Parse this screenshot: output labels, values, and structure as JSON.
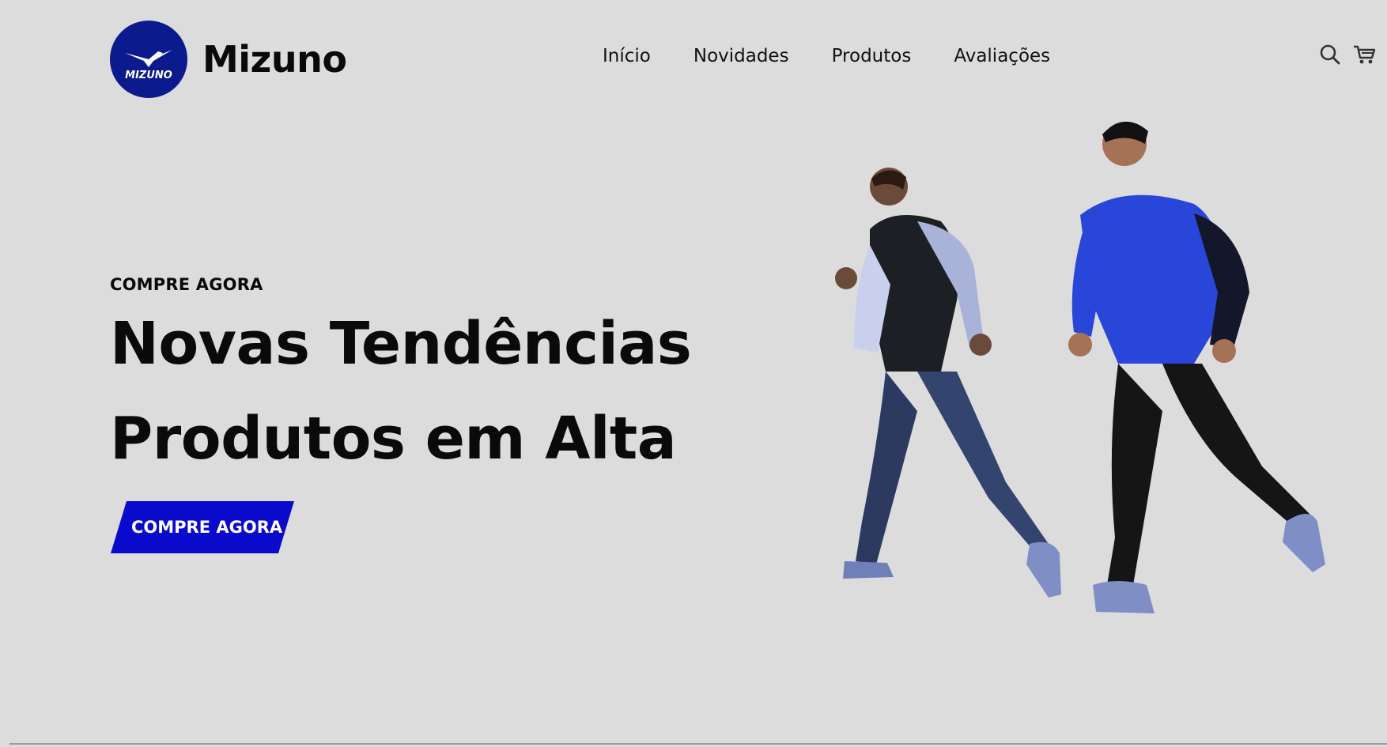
{
  "header": {
    "brand": "Mizuno",
    "logo_text": "MIZUNO",
    "nav": [
      "Início",
      "Novidades",
      "Produtos",
      "Avaliações"
    ],
    "icons": [
      "search-icon",
      "cart-icon"
    ]
  },
  "hero": {
    "eyebrow": "COMPRE AGORA",
    "headline_line1": "Novas Tendências",
    "headline_line2": "Produtos em Alta",
    "cta_label": "COMPRE AGORA"
  },
  "colors": {
    "background": "#dcdcdc",
    "brand_blue": "#0b1a8c",
    "cta_blue": "#0a0acc"
  }
}
